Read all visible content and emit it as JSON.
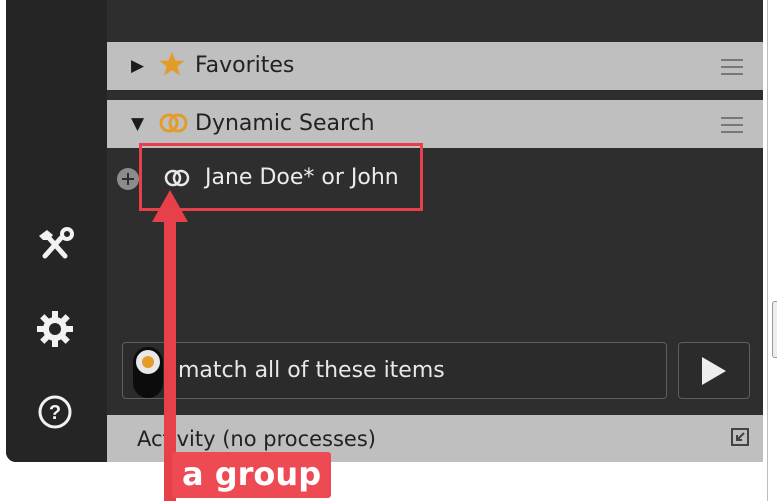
{
  "sidebar": {
    "tools_icon": "tools-icon",
    "settings_icon": "gear-icon",
    "help_icon": "help-icon"
  },
  "favorites": {
    "label": "Favorites",
    "expand_icon": "triangle-right-icon",
    "icon": "star-icon",
    "menu_icon": "hamburger-menu-icon"
  },
  "dynamic_search": {
    "label": "Dynamic Search",
    "expand_icon": "triangle-down-icon",
    "icon": "interlocked-rings-icon",
    "menu_icon": "hamburger-menu-icon",
    "items": [
      {
        "label": "Jane Doe* or John",
        "icon": "interlocked-rings-icon"
      }
    ],
    "add_icon": "plus-circle-icon"
  },
  "match_bar": {
    "text": "match all of these items",
    "toggle_state": "on",
    "run_icon": "play-icon"
  },
  "activity": {
    "label": "Activity (no processes)",
    "corner_icon": "collapse-corner-icon"
  },
  "annotation": {
    "label": "a group"
  },
  "colors": {
    "panel_bg": "#2e2e2e",
    "rail_bg": "#252525",
    "header_bg": "#bfbfbf",
    "accent_orange": "#e39b2a",
    "annotation_red": "#ee4a53"
  }
}
